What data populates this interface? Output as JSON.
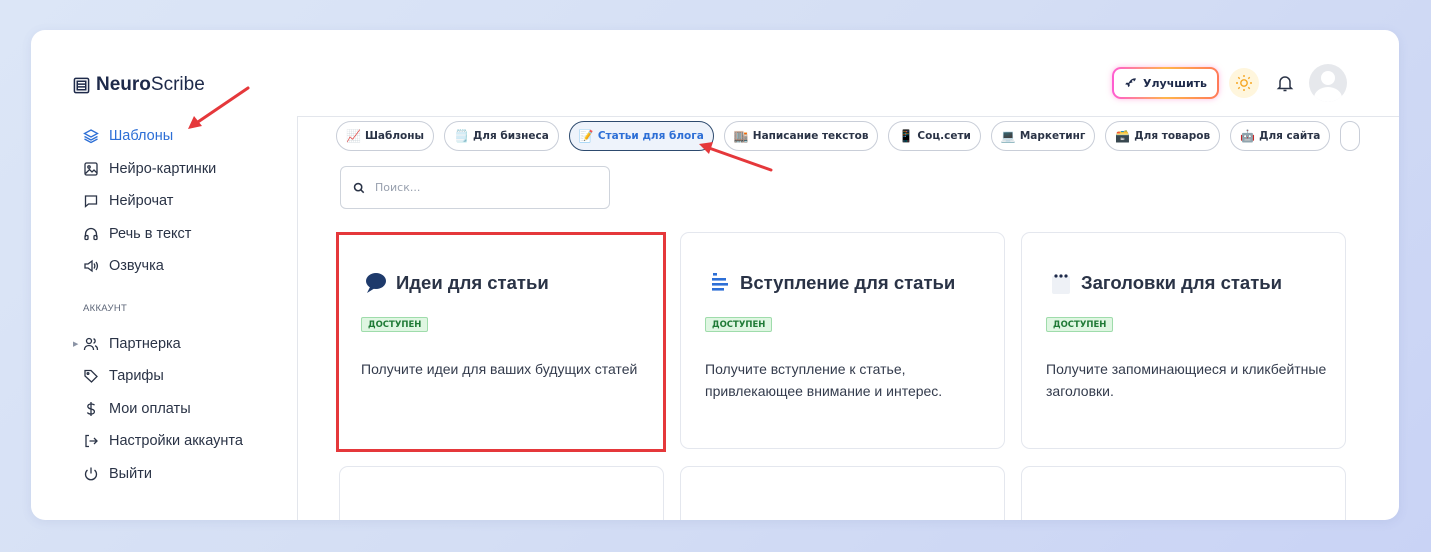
{
  "app": {
    "brand_bold": "Neuro",
    "brand_light": "Scribe"
  },
  "header": {
    "upgrade_label": "Улучшить"
  },
  "sidebar": {
    "items": [
      {
        "label": "Шаблоны",
        "icon": "layers-icon",
        "active": true
      },
      {
        "label": "Нейро-картинки",
        "icon": "image-icon"
      },
      {
        "label": "Нейрочат",
        "icon": "chat-icon"
      },
      {
        "label": "Речь в текст",
        "icon": "headphones-icon"
      },
      {
        "label": "Озвучка",
        "icon": "speaker-icon"
      }
    ],
    "account_label": "АККАУНТ",
    "account_items": [
      {
        "label": "Партнерка",
        "icon": "users-icon"
      },
      {
        "label": "Тарифы",
        "icon": "tag-icon"
      },
      {
        "label": "Мои оплаты",
        "icon": "dollar-icon"
      },
      {
        "label": "Настройки аккаунта",
        "icon": "login-icon"
      },
      {
        "label": "Выйти",
        "icon": "power-icon"
      }
    ]
  },
  "chips": [
    {
      "emoji": "📈",
      "label": "Шаблоны"
    },
    {
      "emoji": "🗒️",
      "label": "Для бизнеса"
    },
    {
      "emoji": "📝",
      "label": "Статьи для блога",
      "active": true
    },
    {
      "emoji": "🏬",
      "label": "Написание текстов"
    },
    {
      "emoji": "📱",
      "label": "Соц.сети"
    },
    {
      "emoji": "💻",
      "label": "Маркетинг"
    },
    {
      "emoji": "🗃️",
      "label": "Для товаров"
    },
    {
      "emoji": "🤖",
      "label": "Для сайта"
    }
  ],
  "search": {
    "placeholder": "Поиск..."
  },
  "cards": [
    {
      "icon": "speech-bubble-icon",
      "title": "Идеи для статьи",
      "badge": "ДОСТУПЕН",
      "desc": "Получите идеи для ваших будущих статей"
    },
    {
      "icon": "text-lines-icon",
      "title": "Вступление для статьи",
      "badge": "ДОСТУПЕН",
      "desc": "Получите вступление к статье, привлекающее внимание и интерес."
    },
    {
      "icon": "notepad-icon",
      "title": "Заголовки для статьи",
      "badge": "ДОСТУПЕН",
      "desc": "Получите запоминающиеся и кликбейтные заголовки."
    }
  ],
  "colors": {
    "accent": "#2d6fd6",
    "highlight": "#e5383b",
    "badge_bg": "#dff6e2",
    "badge_text": "#1f7a36"
  }
}
